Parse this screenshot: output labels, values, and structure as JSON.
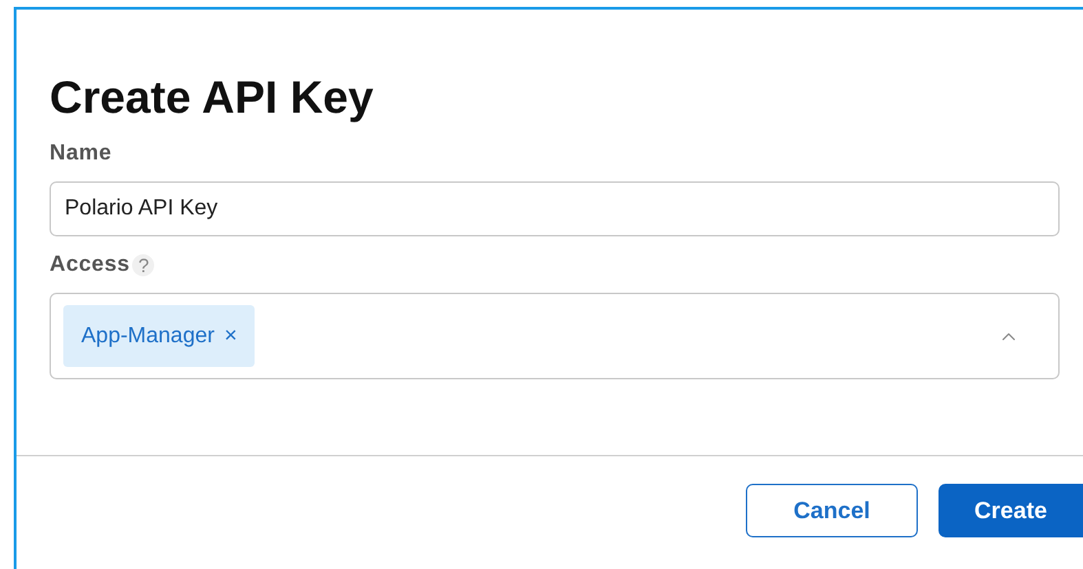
{
  "dialog": {
    "title": "Create API Key",
    "fields": [
      {
        "kind": "text",
        "label": "Name",
        "value": "Polario API Key"
      },
      {
        "kind": "multiselect",
        "label": "Access",
        "help": "?",
        "tags": [
          {
            "label": "App-Manager",
            "remove": "×"
          }
        ],
        "expanded": true
      }
    ],
    "buttons": [
      {
        "label": "Cancel",
        "primary": false
      },
      {
        "label": "Create",
        "primary": true
      }
    ]
  }
}
